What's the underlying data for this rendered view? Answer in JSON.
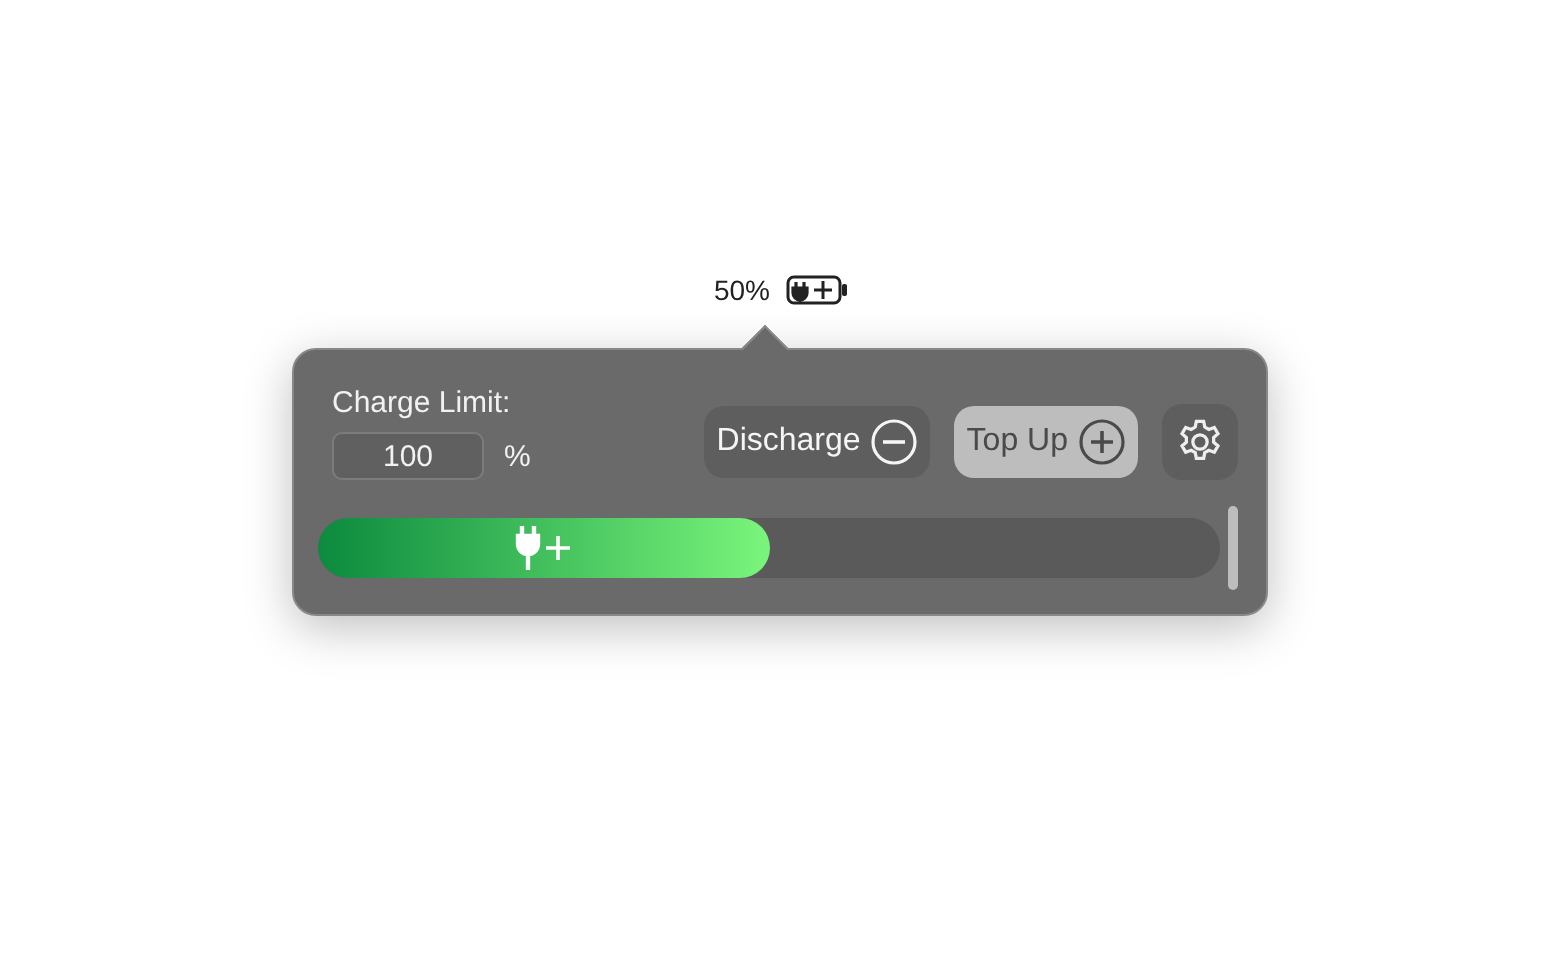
{
  "menu_bar": {
    "percentage": "50%"
  },
  "popover": {
    "limit_label": "Charge Limit:",
    "limit_field": {
      "value": "100"
    },
    "limit_unit": "%",
    "buttons": [
      {
        "label": "Discharge",
        "kind": "minus",
        "selected": false
      },
      {
        "label": "Top Up",
        "kind": "plus",
        "selected": true
      }
    ],
    "charge_bar": {
      "level": 0.5
    }
  }
}
